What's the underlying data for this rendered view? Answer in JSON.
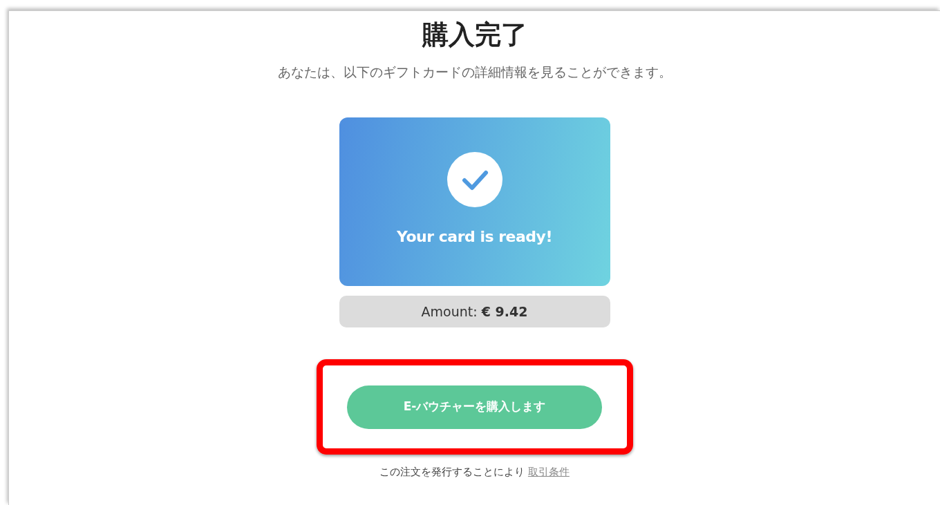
{
  "title": "購入完了",
  "subtitle": "あなたは、以下のギフトカードの詳細情報を見ることができます。",
  "card": {
    "message": "Your card is ready!"
  },
  "amount": "Amount: **€ 9.42**",
  "buy_button": {
    "label": "E-バウチャーを購入します",
    "highlighted": true
  },
  "terms": {
    "text": "この注文を発行することにより",
    "link": "取引条件"
  }
}
